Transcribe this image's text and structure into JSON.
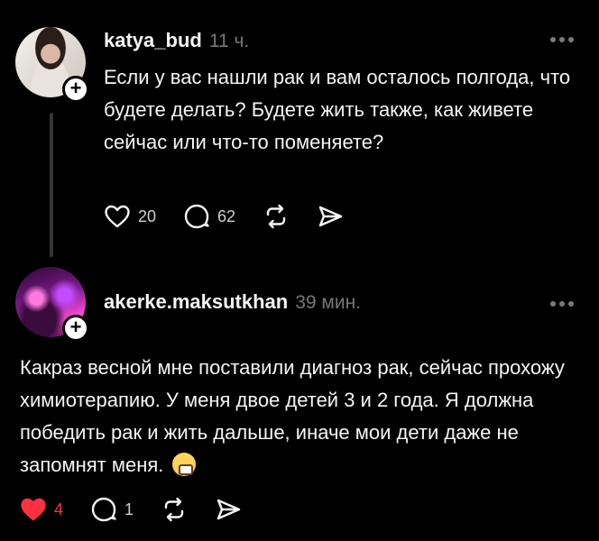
{
  "post1": {
    "username": "katya_bud",
    "time": "11 ч.",
    "text": "Если у вас нашли рак и вам осталось полгода, что будете делать? Будете жить также, как живете сейчас или что-то поменяете?",
    "likes": "20",
    "replies": "62",
    "liked": false
  },
  "post2": {
    "username": "akerke.maksutkhan",
    "time": "39 мин.",
    "text": "Какраз весной мне поставили диагноз рак, сейчас прохожу химиотерапию. У меня двое детей 3 и 2 года. Я должна победить рак и жить дальше, иначе мои дети даже не запомнят меня.",
    "emoji": "weary-face",
    "likes": "4",
    "replies": "1",
    "liked": true
  },
  "colors": {
    "background": "#000000",
    "text": "#f3f5f7",
    "muted": "#777777",
    "like_active": "#ff3040"
  },
  "icons": [
    "plus-icon",
    "more-icon",
    "heart-icon",
    "comment-icon",
    "repost-icon",
    "share-icon"
  ]
}
